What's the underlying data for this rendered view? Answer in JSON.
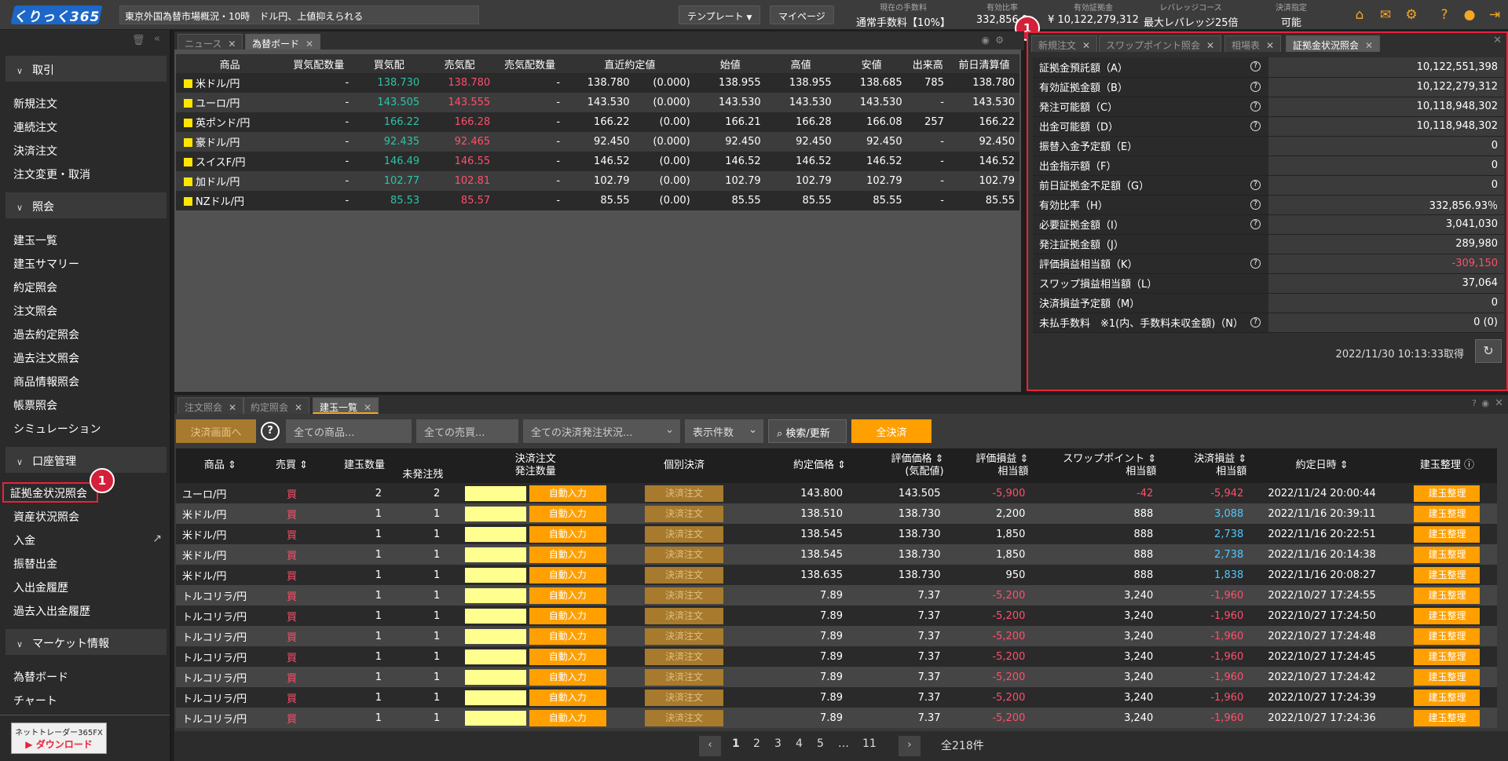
{
  "header": {
    "logo": "くりっく365",
    "news": "東京外国為替市場概況・10時　ドル円、上値抑えられる",
    "template_btn": "テンプレート",
    "mypage_btn": "マイページ",
    "info": [
      {
        "label": "現在の手数料",
        "value": "通常手数料【10%】"
      },
      {
        "label": "有効比率",
        "value": "332,856.9"
      },
      {
        "label": "有効証拠金",
        "value": "¥ 10,122,279,312"
      },
      {
        "label": "レバレッジコース",
        "value": "最大レバレッジ25倍"
      },
      {
        "label": "決済指定",
        "value": "可能"
      }
    ]
  },
  "sidebar": {
    "sections": [
      "取引",
      "照会",
      "口座管理",
      "マーケット情報"
    ],
    "trade": [
      "新規注文",
      "連続注文",
      "決済注文",
      "注文変更・取消"
    ],
    "inquiry": [
      "建玉一覧",
      "建玉サマリー",
      "約定照会",
      "注文照会",
      "過去約定照会",
      "過去注文照会",
      "商品情報照会",
      "帳票照会",
      "シミュレーション"
    ],
    "account": [
      "証拠金状況照会",
      "資産状況照会",
      "入金",
      "振替出金",
      "入出金履歴",
      "過去入出金履歴"
    ],
    "market": [
      "為替ボード",
      "チャート"
    ],
    "download_top": "ネットトレーダー365FX",
    "download_bottom": "ダウンロード",
    "badge": "1"
  },
  "fx": {
    "tabs": [
      "ニュース",
      "為替ボード"
    ],
    "headers": [
      "商品",
      "買気配数量",
      "買気配",
      "売気配",
      "売気配数量",
      "直近約定値",
      "始値",
      "高値",
      "安値",
      "出来高",
      "前日清算値"
    ],
    "rows": [
      [
        "米ドル/円",
        "-",
        "138.730",
        "138.780",
        "-",
        "138.780",
        "(0.000)",
        "138.955",
        "138.955",
        "138.685",
        "785",
        "138.780"
      ],
      [
        "ユーロ/円",
        "-",
        "143.505",
        "143.555",
        "-",
        "143.530",
        "(0.000)",
        "143.530",
        "143.530",
        "143.530",
        "-",
        "143.530"
      ],
      [
        "英ポンド/円",
        "-",
        "166.22",
        "166.28",
        "-",
        "166.22",
        "(0.00)",
        "166.21",
        "166.28",
        "166.08",
        "257",
        "166.22"
      ],
      [
        "豪ドル/円",
        "-",
        "92.435",
        "92.465",
        "-",
        "92.450",
        "(0.000)",
        "92.450",
        "92.450",
        "92.450",
        "-",
        "92.450"
      ],
      [
        "スイスF/円",
        "-",
        "146.49",
        "146.55",
        "-",
        "146.52",
        "(0.00)",
        "146.52",
        "146.52",
        "146.52",
        "-",
        "146.52"
      ],
      [
        "加ドル/円",
        "-",
        "102.77",
        "102.81",
        "-",
        "102.79",
        "(0.00)",
        "102.79",
        "102.79",
        "102.79",
        "-",
        "102.79"
      ],
      [
        "NZドル/円",
        "-",
        "85.53",
        "85.57",
        "-",
        "85.55",
        "(0.00)",
        "85.55",
        "85.55",
        "85.55",
        "-",
        "85.55"
      ]
    ]
  },
  "margin": {
    "tabs": [
      "新規注文",
      "スワップポイント照会",
      "相場表",
      "証拠金状況照会"
    ],
    "rows": [
      [
        "証拠金預託額（A）",
        "10,122,551,398",
        true
      ],
      [
        "有効証拠金額（B）",
        "10,122,279,312",
        true
      ],
      [
        "発注可能額（C）",
        "10,118,948,302",
        true
      ],
      [
        "出金可能額（D）",
        "10,118,948,302",
        true
      ],
      [
        "振替入金予定額（E）",
        "0",
        false
      ],
      [
        "出金指示額（F）",
        "0",
        false
      ],
      [
        "前日証拠金不足額（G）",
        "0",
        true
      ],
      [
        "有効比率（H）",
        "332,856.93％",
        true
      ],
      [
        "必要証拠金額（I）",
        "3,041,030",
        true
      ],
      [
        "発注証拠金額（J）",
        "289,980",
        false
      ],
      [
        "評価損益相当額（K）",
        "-309,150",
        true
      ],
      [
        "スワップ損益相当額（L）",
        "37,064",
        false
      ],
      [
        "決済損益予定額（M）",
        "0",
        false
      ],
      [
        "未払手数料　※1(内、手数料未収金額)（N）",
        "0 (0)",
        true
      ]
    ],
    "timestamp": "2022/11/30 10:13:33取得"
  },
  "positions": {
    "tabs": [
      "注文照会",
      "約定照会",
      "建玉一覧"
    ],
    "toolbar": {
      "settle_screen": "決済画面へ",
      "help": "?",
      "product": "全ての商品...",
      "side": "全ての売買...",
      "status": "全ての決済発注状況...",
      "count": "表示件数",
      "search": "検索/更新",
      "settle_all": "全決済"
    },
    "headers": {
      "product": "商品",
      "side": "売買",
      "qty": "建玉数量",
      "settle": "決済注文",
      "unfilled": "未発注残",
      "order_qty": "発注数量",
      "individual": "個別決済",
      "price": "約定価格",
      "eval_price": "評価価格",
      "eval_price2": "(気配値)",
      "eval_pl": "評価損益",
      "eval_pl2": "相当額",
      "swap": "スワップポイント",
      "swap2": "相当額",
      "settle_pl": "決済損益",
      "settle_pl2": "相当額",
      "date": "約定日時",
      "manage": "建玉整理"
    },
    "auto": "自動入力",
    "settle_btn": "決済注文",
    "manage_btn": "建玉整理",
    "rows": [
      [
        "ユーロ/円",
        "買",
        "2",
        "2",
        "143.800",
        "143.505",
        "-5,900",
        "-42",
        "-5,942",
        "2022/11/24 20:00:44"
      ],
      [
        "米ドル/円",
        "買",
        "1",
        "1",
        "138.510",
        "138.730",
        "2,200",
        "888",
        "3,088",
        "2022/11/16 20:39:11"
      ],
      [
        "米ドル/円",
        "買",
        "1",
        "1",
        "138.545",
        "138.730",
        "1,850",
        "888",
        "2,738",
        "2022/11/16 20:22:51"
      ],
      [
        "米ドル/円",
        "買",
        "1",
        "1",
        "138.545",
        "138.730",
        "1,850",
        "888",
        "2,738",
        "2022/11/16 20:14:38"
      ],
      [
        "米ドル/円",
        "買",
        "1",
        "1",
        "138.635",
        "138.730",
        "950",
        "888",
        "1,838",
        "2022/11/16 20:08:27"
      ],
      [
        "トルコリラ/円",
        "買",
        "1",
        "1",
        "7.89",
        "7.37",
        "-5,200",
        "3,240",
        "-1,960",
        "2022/10/27 17:24:55"
      ],
      [
        "トルコリラ/円",
        "買",
        "1",
        "1",
        "7.89",
        "7.37",
        "-5,200",
        "3,240",
        "-1,960",
        "2022/10/27 17:24:50"
      ],
      [
        "トルコリラ/円",
        "買",
        "1",
        "1",
        "7.89",
        "7.37",
        "-5,200",
        "3,240",
        "-1,960",
        "2022/10/27 17:24:48"
      ],
      [
        "トルコリラ/円",
        "買",
        "1",
        "1",
        "7.89",
        "7.37",
        "-5,200",
        "3,240",
        "-1,960",
        "2022/10/27 17:24:45"
      ],
      [
        "トルコリラ/円",
        "買",
        "1",
        "1",
        "7.89",
        "7.37",
        "-5,200",
        "3,240",
        "-1,960",
        "2022/10/27 17:24:42"
      ],
      [
        "トルコリラ/円",
        "買",
        "1",
        "1",
        "7.89",
        "7.37",
        "-5,200",
        "3,240",
        "-1,960",
        "2022/10/27 17:24:39"
      ],
      [
        "トルコリラ/円",
        "買",
        "1",
        "1",
        "7.89",
        "7.37",
        "-5,200",
        "3,240",
        "-1,960",
        "2022/10/27 17:24:36"
      ]
    ],
    "pager": {
      "pages": [
        "1",
        "2",
        "3",
        "4",
        "5",
        "…",
        "11"
      ],
      "total": "全218件"
    }
  }
}
